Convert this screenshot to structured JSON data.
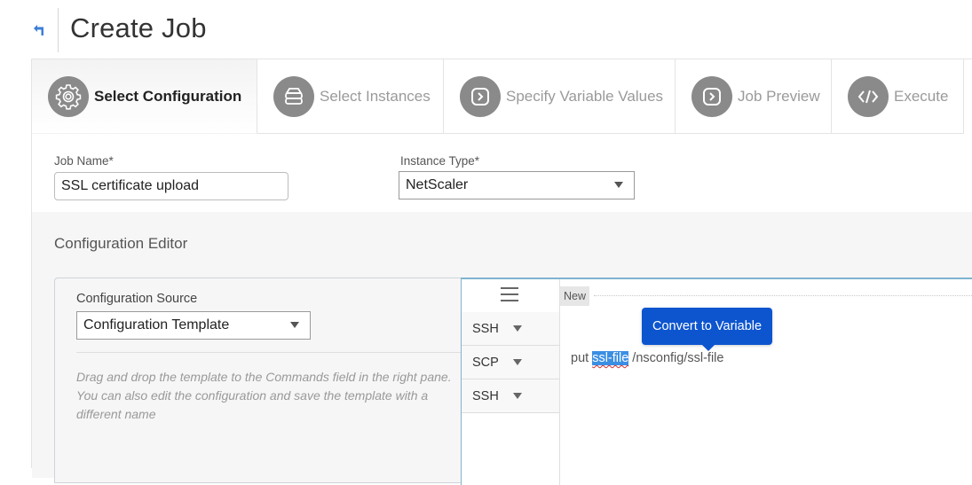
{
  "header": {
    "back_icon": "back-arrow-icon",
    "title": "Create Job"
  },
  "wizard": {
    "steps": [
      {
        "label": "Select Configuration",
        "icon": "gear-icon",
        "active": true
      },
      {
        "label": "Select Instances",
        "icon": "server-stack-icon",
        "active": false
      },
      {
        "label": "Specify Variable Values",
        "icon": "chevron-right-box-icon",
        "active": false
      },
      {
        "label": "Job Preview",
        "icon": "chevron-right-box-icon",
        "active": false
      },
      {
        "label": "Execute",
        "icon": "code-icon",
        "active": false
      }
    ]
  },
  "form": {
    "job_name_label": "Job Name*",
    "job_name_value": "SSL certificate upload",
    "instance_type_label": "Instance Type*",
    "instance_type_value": "NetScaler"
  },
  "editor": {
    "section_title": "Configuration Editor",
    "source_label": "Configuration Source",
    "source_value": "Configuration Template",
    "hint": "Drag and drop the template to the Commands field in the right pane. You can also edit the configuration and save the template with a different name",
    "menu_icon": "hamburger-menu-icon",
    "protocols": [
      "SSH",
      "SCP",
      "SSH"
    ],
    "new_badge": "New",
    "command": {
      "prefix": "put ",
      "selected": "ssl-file",
      "suffix": " /nsconfig/ssl-file"
    },
    "tooltip": "Convert to Variable"
  },
  "colors": {
    "tooltip_bg": "#0d55cf",
    "selection_bg": "#3b8fe3",
    "back_arrow": "#3d7fd6",
    "editor_border": "#7fb3cf",
    "step_icon_bg": "#8a8a8a"
  }
}
